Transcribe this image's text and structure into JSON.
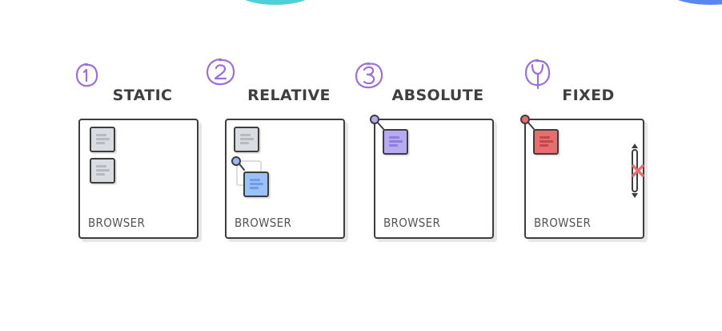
{
  "panels": [
    {
      "number": "1",
      "title": "STATIC",
      "browser_label": "BROWSER"
    },
    {
      "number": "2",
      "title": "RELATIVE",
      "browser_label": "BROWSER"
    },
    {
      "number": "3",
      "title": "ABSOLUTE",
      "browser_label": "BROWSER"
    },
    {
      "number": "4",
      "title": "FIXED",
      "browser_label": "BROWSER"
    }
  ],
  "colors": {
    "number_circle": "#9b6fd9",
    "outline": "#3d3d3d",
    "static_box": "#d9dde2",
    "relative_box": "#9cc2f5",
    "absolute_box": "#b7aaf0",
    "fixed_box": "#e56e6e",
    "fixed_marker": "#e56e6e"
  }
}
